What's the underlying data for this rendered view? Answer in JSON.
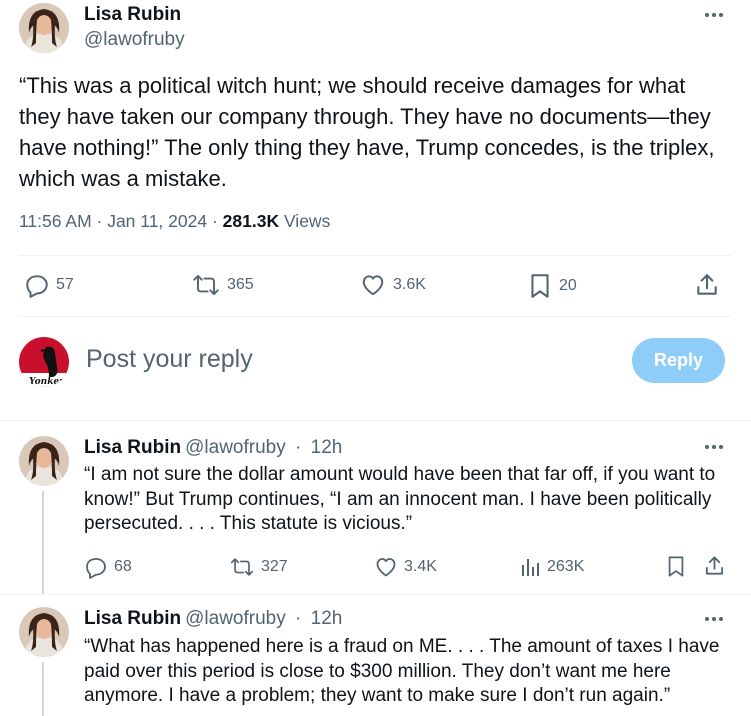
{
  "main_tweet": {
    "author_name": "Lisa Rubin",
    "author_handle": "@lawofruby",
    "text": "“This was a political witch hunt; we should receive damages for what they have taken our company through. They have no documents—they have nothing!” The only thing they have, Trump concedes, is the triplex, which was a mistake.",
    "time_date": "11:56 AM · Jan 11, 2024 · ",
    "views_count": "281.3K",
    "views_label": " Views",
    "stats": {
      "replies": "57",
      "reposts": "365",
      "likes": "3.6K",
      "bookmarks": "20"
    }
  },
  "reply_composer": {
    "placeholder": "Post your reply",
    "button_label": "Reply"
  },
  "thread_replies": [
    {
      "author_name": "Lisa Rubin",
      "author_handle": "@lawofruby",
      "sep": " · ",
      "time": "12h",
      "text": "“I am not sure the dollar amount would have been that far off, if you want to know!” But Trump continues, “I am an innocent man. I have been politically persecuted. . . . This statute is vicious.”",
      "stats": {
        "replies": "68",
        "reposts": "327",
        "likes": "3.4K",
        "views": "263K"
      }
    },
    {
      "author_name": "Lisa Rubin",
      "author_handle": "@lawofruby",
      "sep": " · ",
      "time": "12h",
      "text": "“What has happened here is a fraud on ME. . . . The amount of taxes I have paid over this period is close to $300 million. They don’t want me here anymore. I have a problem; they want to make sure I don’t run again.”"
    }
  ],
  "colors": {
    "text_primary": "#0f1419",
    "text_secondary": "#536471",
    "reply_button": "#8ecdf8",
    "divider": "#eff3f4",
    "thread_line": "#cfd9de"
  },
  "icons": [
    "more-icon",
    "reply-icon",
    "repost-icon",
    "like-icon",
    "bookmark-icon",
    "share-icon",
    "views-icon"
  ]
}
